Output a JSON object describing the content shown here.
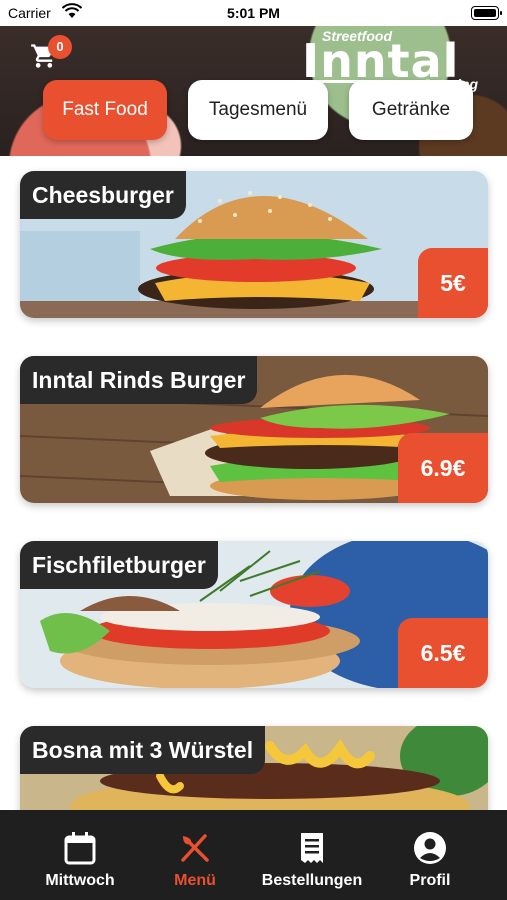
{
  "status_bar": {
    "carrier": "Carrier",
    "time": "5:01 PM"
  },
  "header": {
    "cart_count": "0",
    "logo": {
      "top": "Streetfood",
      "main": "Inntal",
      "bottom": "Catering"
    }
  },
  "tabs": [
    {
      "label": "Fast Food",
      "active": true
    },
    {
      "label": "Tagesmenü",
      "active": false
    },
    {
      "label": "Getränke",
      "active": false
    }
  ],
  "menu_items": [
    {
      "name": "Cheesburger",
      "price": "5€"
    },
    {
      "name": "Inntal Rinds Burger",
      "price": "6.9€"
    },
    {
      "name": "Fischfiletburger",
      "price": "6.5€"
    },
    {
      "name": "Bosna mit 3 Würstel",
      "price": ""
    }
  ],
  "bottom_nav": [
    {
      "label": "Mittwoch",
      "icon": "calendar-icon",
      "active": false
    },
    {
      "label": "Menü",
      "icon": "cutlery-icon",
      "active": true
    },
    {
      "label": "Bestellungen",
      "icon": "receipt-icon",
      "active": false
    },
    {
      "label": "Profil",
      "icon": "profile-icon",
      "active": false
    }
  ],
  "colors": {
    "accent": "#e8502f",
    "dark": "#2a2a2a",
    "nav_bg": "#1f1f1f"
  }
}
